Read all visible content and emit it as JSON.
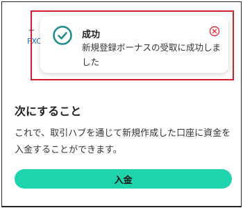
{
  "background": {
    "snippet_top": "+",
    "snippet_link": "FXC"
  },
  "toast": {
    "title": "成功",
    "message": "新規登録ボーナスの受取に成功しました",
    "icon": "check-circle-icon",
    "close_icon": "close-circle-icon",
    "accent_color": "#1a8a8a",
    "close_color": "#d9333f"
  },
  "next_section": {
    "title": "次にすること",
    "body": "これで、取引ハブを通じて新規作成した口座に資金を入金することができます。"
  },
  "deposit_button": {
    "label": "入金",
    "color": "#1fd4ad"
  },
  "highlight_color": "#d01c2c"
}
